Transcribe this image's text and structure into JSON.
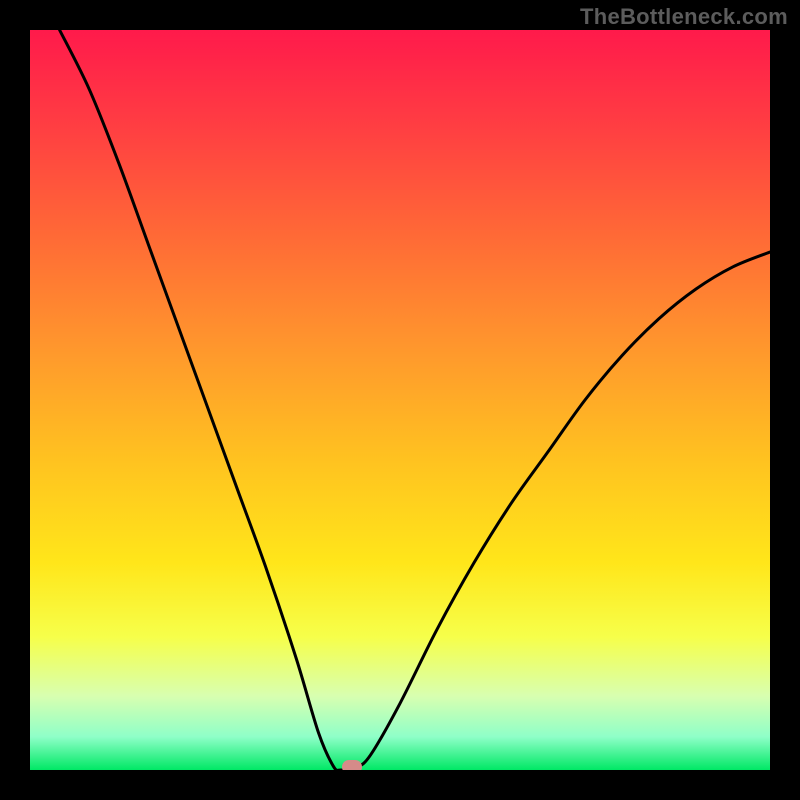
{
  "watermark": "TheBottleneck.com",
  "chart_data": {
    "type": "line",
    "title": "",
    "xlabel": "",
    "ylabel": "",
    "xlim": [
      0,
      100
    ],
    "ylim": [
      0,
      100
    ],
    "grid": false,
    "legend": null,
    "background_gradient": {
      "stops": [
        {
          "offset": 0.0,
          "color": "#ff1a4b"
        },
        {
          "offset": 0.12,
          "color": "#ff3b43"
        },
        {
          "offset": 0.28,
          "color": "#ff6a36"
        },
        {
          "offset": 0.44,
          "color": "#ff9a2c"
        },
        {
          "offset": 0.58,
          "color": "#ffc220"
        },
        {
          "offset": 0.72,
          "color": "#ffe61a"
        },
        {
          "offset": 0.82,
          "color": "#f6ff4a"
        },
        {
          "offset": 0.9,
          "color": "#d8ffb0"
        },
        {
          "offset": 0.955,
          "color": "#8fffc8"
        },
        {
          "offset": 1.0,
          "color": "#00e865"
        }
      ]
    },
    "curve": {
      "description": "Bottleneck V-curve: near 100 at x≈4, drops smoothly to 0 at x≈42, rises smoothly to ≈70 at x=100",
      "minimum_x": 42,
      "left_start": {
        "x": 4,
        "y": 100
      },
      "right_end": {
        "x": 100,
        "y": 70
      },
      "series": [
        {
          "x": 4,
          "y": 100
        },
        {
          "x": 8,
          "y": 92
        },
        {
          "x": 12,
          "y": 82
        },
        {
          "x": 16,
          "y": 71
        },
        {
          "x": 20,
          "y": 60
        },
        {
          "x": 24,
          "y": 49
        },
        {
          "x": 28,
          "y": 38
        },
        {
          "x": 32,
          "y": 27
        },
        {
          "x": 36,
          "y": 15
        },
        {
          "x": 39,
          "y": 5
        },
        {
          "x": 41,
          "y": 0.5
        },
        {
          "x": 42,
          "y": 0
        },
        {
          "x": 44,
          "y": 0.3
        },
        {
          "x": 46,
          "y": 2
        },
        {
          "x": 50,
          "y": 9
        },
        {
          "x": 55,
          "y": 19
        },
        {
          "x": 60,
          "y": 28
        },
        {
          "x": 65,
          "y": 36
        },
        {
          "x": 70,
          "y": 43
        },
        {
          "x": 75,
          "y": 50
        },
        {
          "x": 80,
          "y": 56
        },
        {
          "x": 85,
          "y": 61
        },
        {
          "x": 90,
          "y": 65
        },
        {
          "x": 95,
          "y": 68
        },
        {
          "x": 100,
          "y": 70
        }
      ]
    },
    "marker": {
      "x": 43.5,
      "y": 0,
      "color": "#d58b89",
      "shape": "rounded-rect"
    }
  },
  "colors": {
    "frame": "#000000",
    "curve": "#000000",
    "marker": "#d58b89",
    "watermark": "#5c5c5c"
  }
}
